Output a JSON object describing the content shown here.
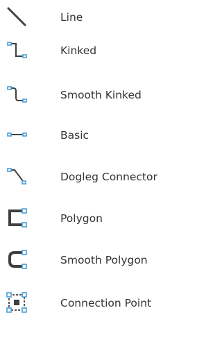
{
  "connector_menu": {
    "items": [
      {
        "label": "Line",
        "icon": "straight-line-icon"
      },
      {
        "label": "Kinked",
        "icon": "kinked-connector-icon"
      },
      {
        "label": "Smooth Kinked",
        "icon": "smooth-kinked-connector-icon"
      },
      {
        "label": "Basic",
        "icon": "basic-connector-icon"
      },
      {
        "label": "Dogleg Connector",
        "icon": "dogleg-connector-icon"
      },
      {
        "label": "Polygon",
        "icon": "polygon-connector-icon"
      },
      {
        "label": "Smooth Polygon",
        "icon": "smooth-polygon-connector-icon"
      },
      {
        "label": "Connection Point",
        "icon": "connection-point-icon"
      }
    ],
    "colors": {
      "stroke": "#404040",
      "endpoint": "#4a9fd8",
      "text": "#333333"
    }
  }
}
